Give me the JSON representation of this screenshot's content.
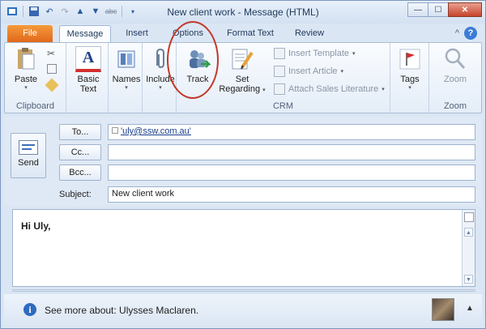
{
  "window": {
    "title": "New client work  -  Message (HTML)",
    "qat_icons": [
      "save-icon",
      "undo-icon",
      "redo-icon",
      "up-icon",
      "down-icon",
      "spelling-icon"
    ],
    "spelling_label": "abc",
    "buttons": [
      "minimize",
      "maximize",
      "close"
    ],
    "close_glyph": "✕",
    "max_glyph": "☐",
    "min_glyph": "—"
  },
  "tabs": {
    "items": [
      "File",
      "Message",
      "Insert",
      "Options",
      "Format Text",
      "Review"
    ],
    "active": "Message",
    "collapse_glyph": "^",
    "help_glyph": "?"
  },
  "ribbon": {
    "clipboard": {
      "label": "Clipboard",
      "paste": "Paste"
    },
    "basic_text": {
      "line1": "Basic",
      "line2": "Text"
    },
    "names": {
      "label": "Names"
    },
    "include": {
      "label": "Include"
    },
    "track": {
      "label": "Track"
    },
    "set_regarding": {
      "line1": "Set",
      "line2": "Regarding"
    },
    "crm_items": [
      "Insert Template",
      "Insert Article",
      "Attach Sales Literature"
    ],
    "crm_label": "CRM",
    "tags": {
      "label": "Tags"
    },
    "zoom": {
      "button": "Zoom",
      "label": "Zoom"
    },
    "dropdown_glyph": "▾"
  },
  "compose": {
    "send_label": "Send",
    "to_label": "To...",
    "cc_label": "Cc...",
    "bcc_label": "Bcc...",
    "subject_label": "Subject:",
    "to_value": "'uly@ssw.com.au'",
    "cc_value": "",
    "bcc_value": "",
    "subject_value": "New client work"
  },
  "message": {
    "body_text": "Hi Uly,"
  },
  "people_pane": {
    "text": "See more about: Ulysses Maclaren.",
    "info_glyph": "i",
    "expand_glyph": "▲"
  },
  "colors": {
    "file_tab": "#e56e1d",
    "highlight_circle": "#c0392b",
    "accent": "#2e6bbf"
  }
}
